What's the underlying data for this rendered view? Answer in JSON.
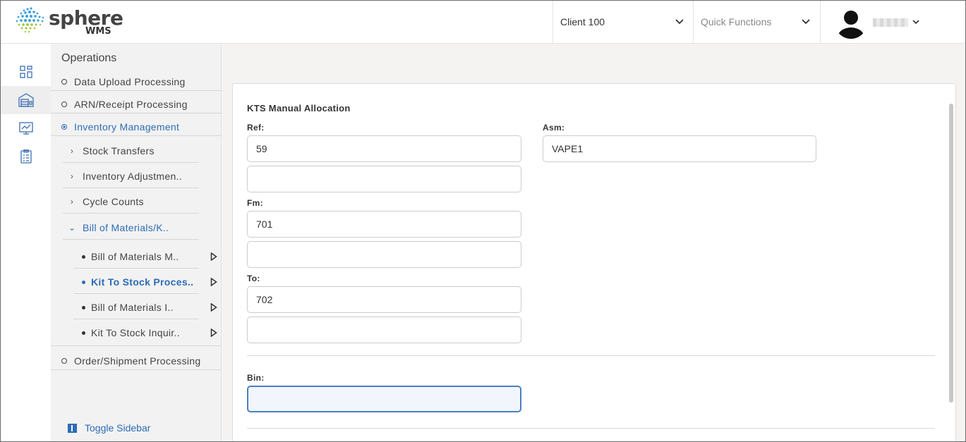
{
  "header": {
    "logo_primary": "sphere",
    "logo_secondary": "WMS",
    "client_selector": "Client 100",
    "quick_functions": "Quick Functions"
  },
  "sidebar": {
    "title": "Operations",
    "items": [
      {
        "label": "Data Upload Processing"
      },
      {
        "label": "ARN/Receipt Processing"
      },
      {
        "label": "Inventory Management"
      },
      {
        "label": "Stock Transfers"
      },
      {
        "label": "Inventory Adjustmen.."
      },
      {
        "label": "Cycle Counts"
      },
      {
        "label": "Bill of Materials/K.."
      },
      {
        "label": "Bill of Materials M.."
      },
      {
        "label": "Kit To Stock Proces.."
      },
      {
        "label": "Bill of Materials I.."
      },
      {
        "label": "Kit To Stock Inquir.."
      },
      {
        "label": "Order/Shipment Processing"
      }
    ],
    "toggle": "Toggle Sidebar"
  },
  "form": {
    "title": "KTS Manual Allocation",
    "ref_label": "Ref:",
    "ref_value": "59",
    "ref_value2": "",
    "asm_label": "Asm:",
    "asm_value": "VAPE1",
    "fm_label": "Fm:",
    "fm_value": "701",
    "fm_value2": "",
    "to_label": "To:",
    "to_value": "702",
    "to_value2": "",
    "bin_label": "Bin:",
    "bin_value": ""
  },
  "colors": {
    "accent": "#2d6cb5",
    "sidebar_bg": "#f2f2f2",
    "main_bg": "#f5f3f2"
  }
}
